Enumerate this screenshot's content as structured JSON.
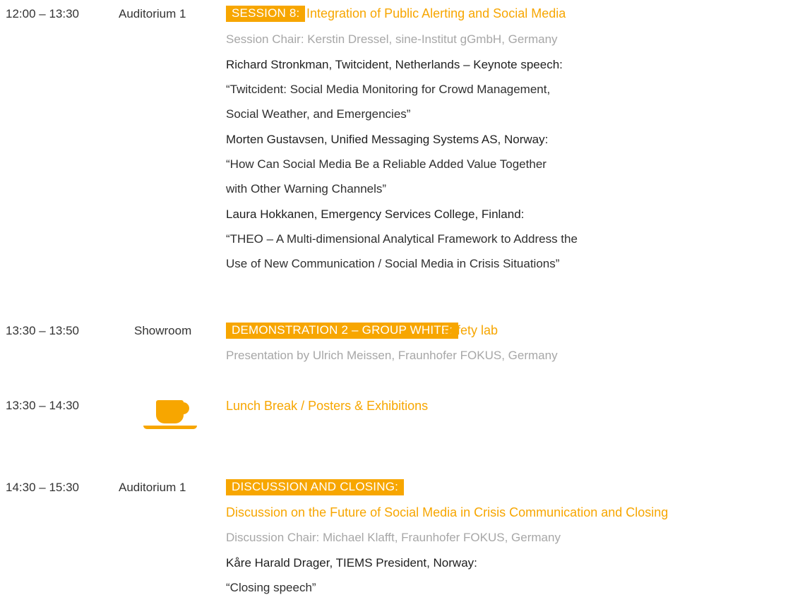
{
  "session8": {
    "time": "12:00 – 13:30",
    "location": "Auditorium 1",
    "badge": "SESSION 8:",
    "title": "Integration of Public Alerting and Social Media",
    "chair": "Session Chair: Kerstin Dressel, sine-Institut gGmbH, Germany",
    "talks": [
      {
        "speaker": "Richard Stronkman, Twitcident, Netherlands – Keynote speech:",
        "title_lines": [
          "“Twitcident: Social Media Monitoring for Crowd Management,",
          "Social Weather, and Emergencies”"
        ]
      },
      {
        "speaker": "Morten Gustavsen, Unified Messaging Systems AS, Norway:",
        "title_lines": [
          "“How Can Social Media Be a Reliable Added Value Together",
          "with Other Warning Channels”"
        ]
      },
      {
        "speaker": "Laura Hokkanen, Emergency Services College, Finland:",
        "title_lines": [
          "“THEO – A Multi-dimensional Analytical Framework to Address the",
          "Use of New Communication / Social Media in Crisis Situations”"
        ]
      }
    ]
  },
  "demo": {
    "time": "13:30 – 13:50",
    "location": "Showroom",
    "badge": "DEMONSTRATION 2 – GROUP WHITE:",
    "title": "safety lab",
    "presenter": "Presentation by Ulrich Meissen, Fraunhofer FOKUS, Germany"
  },
  "lunch": {
    "time": "13:30 – 14:30",
    "icon": "coffee-cup-icon",
    "title": "Lunch Break / Posters & Exhibitions"
  },
  "closing": {
    "time": "14:30 – 15:30",
    "location": "Auditorium 1",
    "badge": "DISCUSSION AND CLOSING:",
    "title": "Discussion on the Future of Social Media in Crisis Communication and Closing",
    "chair": "Discussion Chair: Michael Klafft, Fraunhofer FOKUS, Germany",
    "speaker": "Kåre Harald Drager, TIEMS President, Norway:",
    "talk": "“Closing speech”"
  },
  "colors": {
    "accent": "#f7a600",
    "muted": "#a7a7a7",
    "text": "#2a2a2a"
  }
}
